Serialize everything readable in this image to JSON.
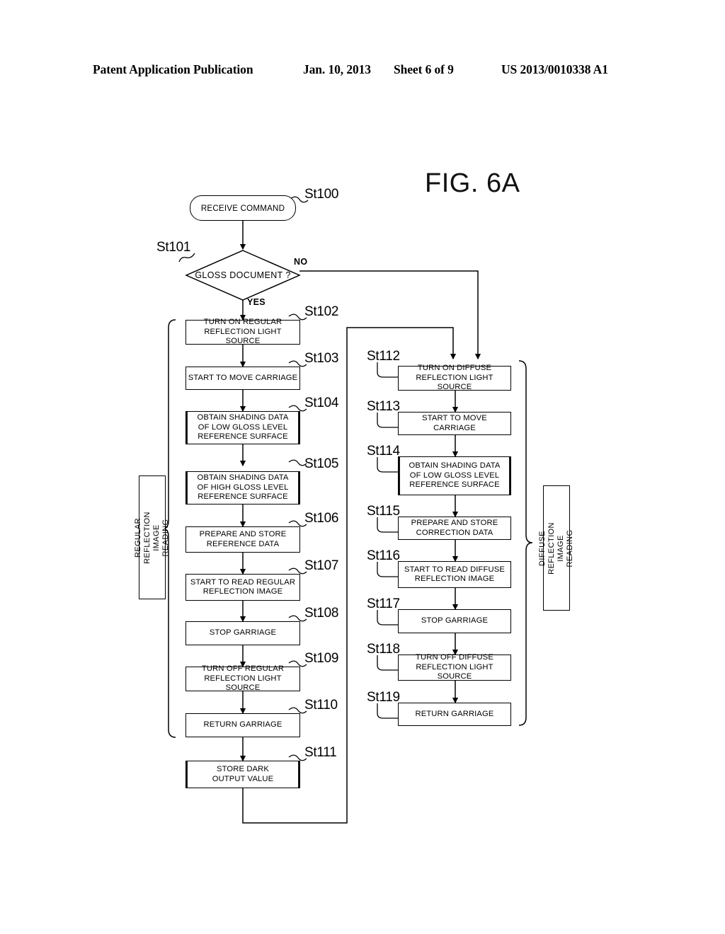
{
  "header": {
    "left": "Patent Application Publication",
    "date": "Jan. 10, 2013",
    "sheet": "Sheet 6 of 9",
    "number": "US 2013/0010338 A1"
  },
  "figure": {
    "title": "FIG. 6A"
  },
  "flowchart": {
    "start": {
      "ref": "St100",
      "label": "RECEIVE COMMAND"
    },
    "decision": {
      "ref": "St101",
      "label": "GLOSS DOCUMENT ?",
      "yes_label": "YES",
      "no_label": "NO"
    },
    "left_group_label": "REGULAR REFLECTION\nIMAGE READING",
    "right_group_label": "DIFFUSE REFLECTION\nIMAGE READING",
    "left_steps": [
      {
        "ref": "St102",
        "label": "TURN ON REGULAR\nREFLECTION LIGHT SOURCE",
        "double": false
      },
      {
        "ref": "St103",
        "label": "START TO MOVE CARRIAGE",
        "double": false
      },
      {
        "ref": "St104",
        "label": "OBTAIN SHADING DATA\nOF LOW GLOSS LEVEL\nREFERENCE SURFACE",
        "double": true
      },
      {
        "ref": "St105",
        "label": "OBTAIN SHADING DATA\nOF HIGH GLOSS LEVEL\nREFERENCE SURFACE",
        "double": true
      },
      {
        "ref": "St106",
        "label": "PREPARE AND STORE\nREFERENCE DATA",
        "double": false
      },
      {
        "ref": "St107",
        "label": "START TO READ REGULAR\nREFLECTION IMAGE",
        "double": false
      },
      {
        "ref": "St108",
        "label": "STOP GARRIAGE",
        "double": false
      },
      {
        "ref": "St109",
        "label": "TURN OFF REGULAR\nREFLECTION LIGHT SOURCE",
        "double": false
      },
      {
        "ref": "St110",
        "label": "RETURN GARRIAGE",
        "double": false
      },
      {
        "ref": "St111",
        "label": "STORE DARK\nOUTPUT VALUE",
        "double": true
      }
    ],
    "right_steps": [
      {
        "ref": "St112",
        "label": "TURN ON DIFFUSE\nREFLECTION LIGHT SOURCE",
        "double": false
      },
      {
        "ref": "St113",
        "label": "START TO MOVE CARRIAGE",
        "double": false
      },
      {
        "ref": "St114",
        "label": "OBTAIN SHADING DATA\nOF LOW GLOSS LEVEL\nREFERENCE SURFACE",
        "double": true
      },
      {
        "ref": "St115",
        "label": "PREPARE AND STORE\nCORRECTION DATA",
        "double": false
      },
      {
        "ref": "St116",
        "label": "START TO READ DIFFUSE\nREFLECTION IMAGE",
        "double": false
      },
      {
        "ref": "St117",
        "label": "STOP GARRIAGE",
        "double": false
      },
      {
        "ref": "St118",
        "label": "TURN OFF DIFFUSE\nREFLECTION LIGHT SOURCE",
        "double": false
      },
      {
        "ref": "St119",
        "label": "RETURN GARRIAGE",
        "double": false
      }
    ]
  },
  "colors": {
    "ink": "#000000",
    "paper": "#ffffff"
  }
}
